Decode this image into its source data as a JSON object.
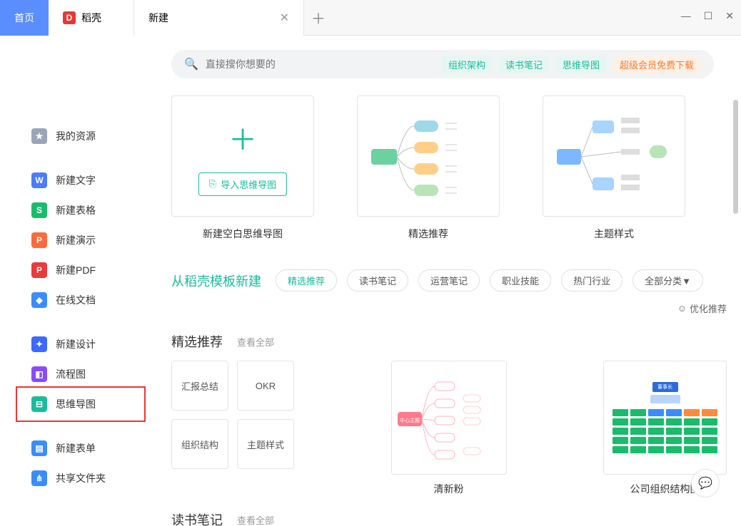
{
  "tabs": {
    "home": "首页",
    "docer": "稻壳",
    "new": "新建"
  },
  "search": {
    "placeholder": "直接搜你想要的",
    "tags": [
      "组织架构",
      "读书笔记",
      "思维导图",
      "超级会员免费下载"
    ]
  },
  "sidebar": {
    "items": [
      {
        "label": "我的资源"
      },
      {
        "label": "新建文字"
      },
      {
        "label": "新建表格"
      },
      {
        "label": "新建演示"
      },
      {
        "label": "新建PDF"
      },
      {
        "label": "在线文档"
      },
      {
        "label": "新建设计"
      },
      {
        "label": "流程图"
      },
      {
        "label": "思维导图"
      },
      {
        "label": "新建表单"
      },
      {
        "label": "共享文件夹"
      }
    ]
  },
  "top_cards": {
    "import_label": "导入思维导图",
    "c0": "新建空白思维导图",
    "c1": "精选推荐",
    "c2": "主题样式"
  },
  "filters": {
    "title": "从稻壳模板新建",
    "chips": [
      "精选推荐",
      "读书笔记",
      "运营笔记",
      "职业技能",
      "热门行业",
      "全部分类▼"
    ],
    "opt_label": "优化推荐"
  },
  "sections": {
    "featured": {
      "title": "精选推荐",
      "more": "查看全部",
      "quick": [
        "汇报总结",
        "OKR",
        "组织结构",
        "主题样式"
      ],
      "tpl1": "清新粉",
      "tpl2": "公司组织结构图",
      "org_top": "董事长"
    },
    "reading": {
      "title": "读书笔记",
      "more": "查看全部"
    }
  }
}
